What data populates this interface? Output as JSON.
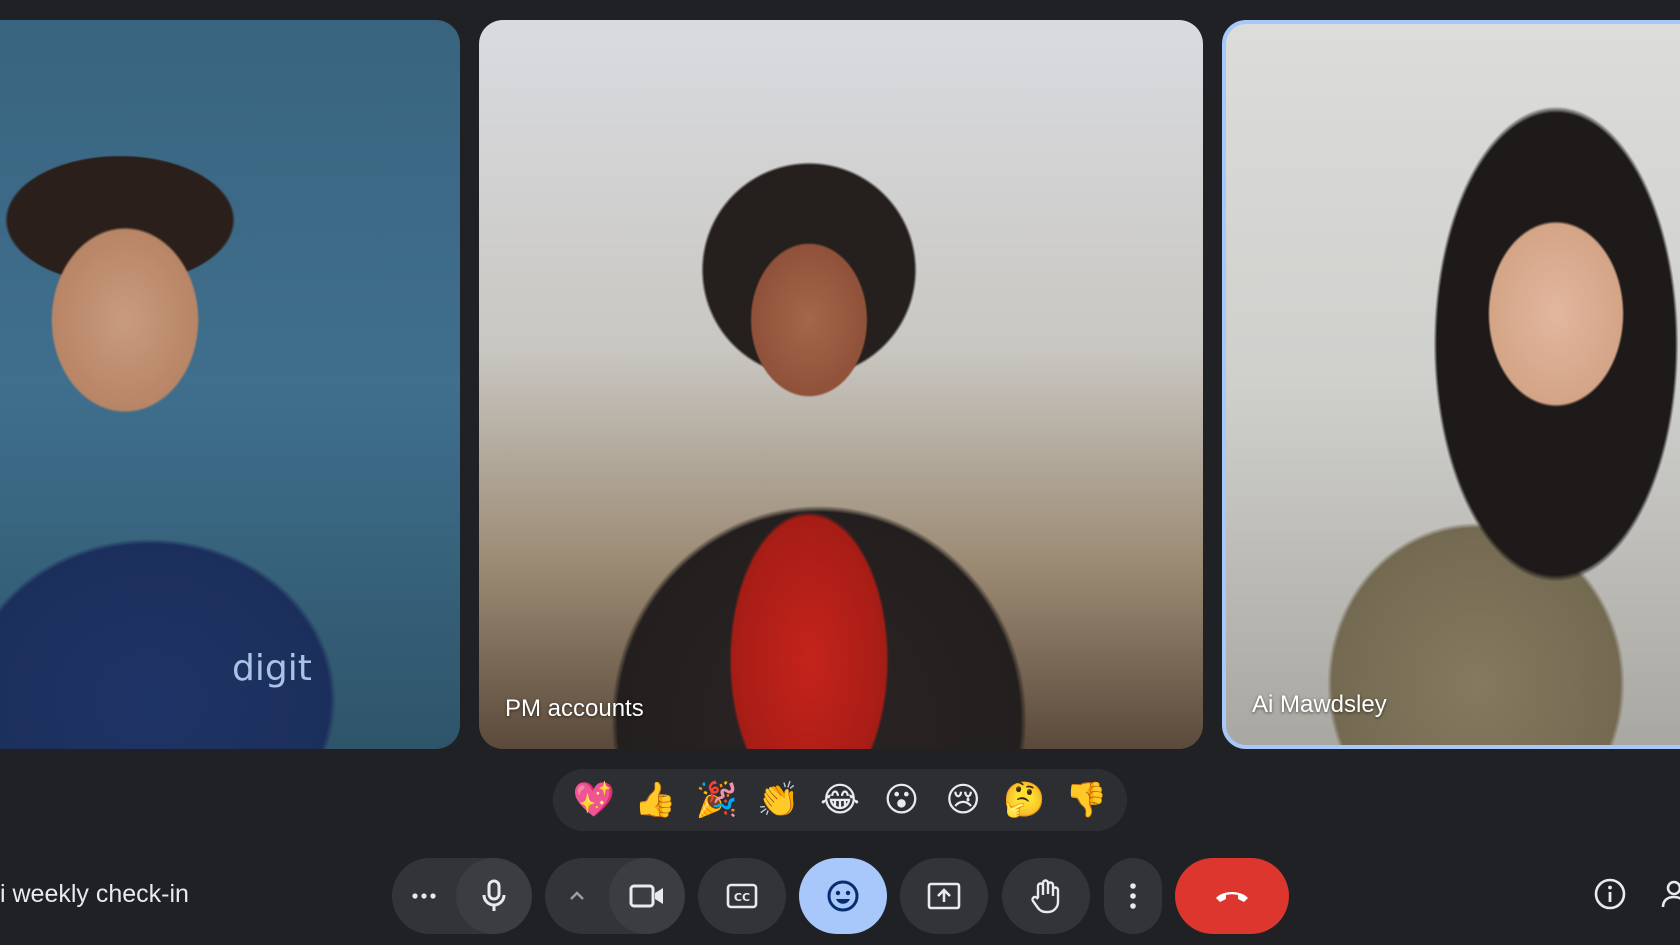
{
  "meeting": {
    "title": "i weekly check-in"
  },
  "participants": [
    {
      "name": ""
    },
    {
      "name": "PM accounts"
    },
    {
      "name": "Ai Mawdsley"
    }
  ],
  "shirt_logo_text": "digit",
  "reactions": [
    {
      "emoji": "💖",
      "label": "sparkling-heart"
    },
    {
      "emoji": "👍",
      "label": "thumbs-up"
    },
    {
      "emoji": "🎉",
      "label": "party-popper"
    },
    {
      "emoji": "👏",
      "label": "clapping-hands"
    },
    {
      "emoji": "😂",
      "label": "tears-of-joy"
    },
    {
      "emoji": "😮",
      "label": "surprised"
    },
    {
      "emoji": "😢",
      "label": "crying"
    },
    {
      "emoji": "🤔",
      "label": "thinking"
    },
    {
      "emoji": "👎",
      "label": "thumbs-down"
    }
  ],
  "controls": {
    "more_audio_icon": "more-horiz-icon",
    "mic_icon": "mic-icon",
    "video_options_icon": "chevron-up-icon",
    "camera_icon": "videocam-icon",
    "captions_icon": "closed-caption-icon",
    "reaction_icon": "emoji-icon",
    "present_icon": "present-screen-icon",
    "raise_hand_icon": "raise-hand-icon",
    "more_options_icon": "more-vert-icon",
    "leave_icon": "call-end-icon",
    "info_icon": "info-icon",
    "people_icon": "people-icon"
  },
  "colors": {
    "background": "#202124",
    "control": "#333438",
    "active_reaction": "#a8c7fa",
    "leave": "#dc362e",
    "speaking_border": "#a8c7fa"
  }
}
